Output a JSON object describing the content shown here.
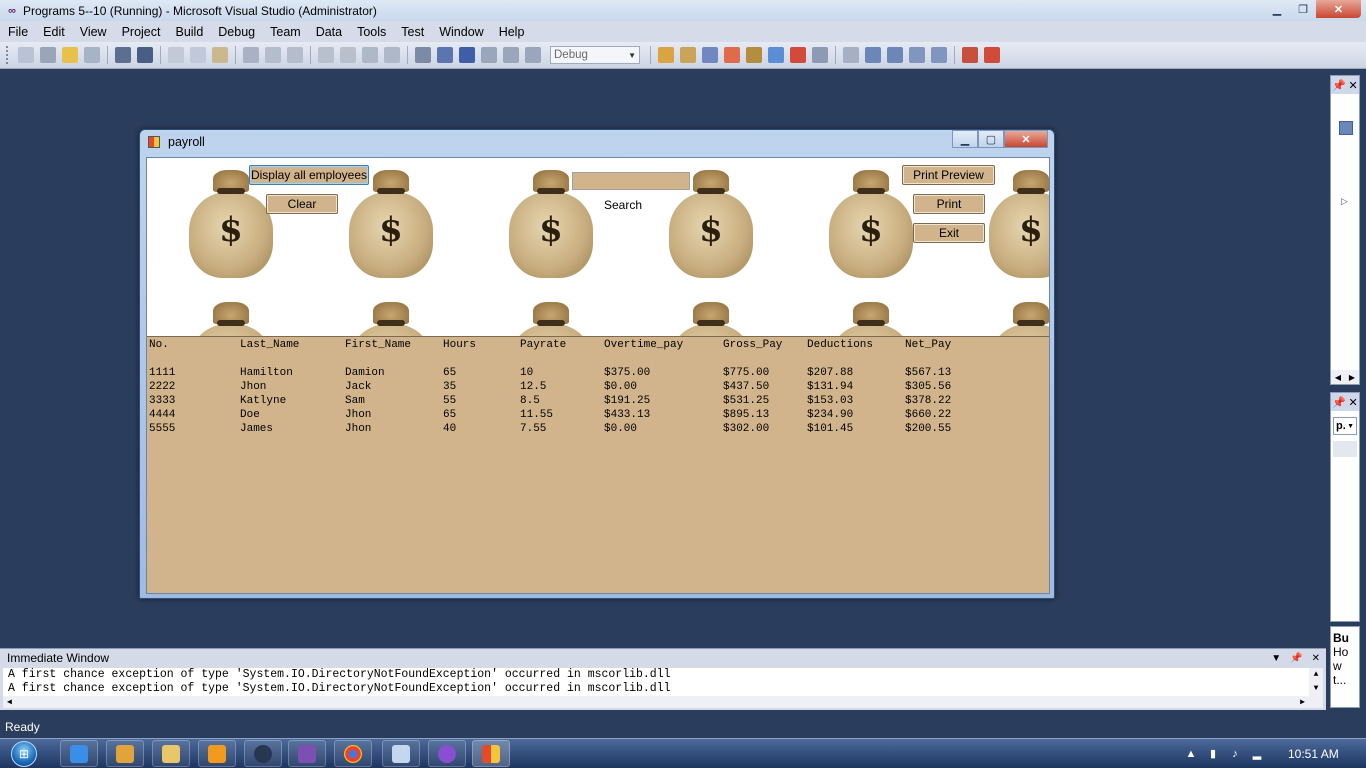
{
  "vs": {
    "title": "Programs 5--10 (Running) - Microsoft Visual Studio (Administrator)",
    "menu": [
      "File",
      "Edit",
      "View",
      "Project",
      "Build",
      "Debug",
      "Team",
      "Data",
      "Tools",
      "Test",
      "Window",
      "Help"
    ],
    "config_combo": "Debug",
    "status": "Ready"
  },
  "immediate": {
    "title": "Immediate Window",
    "lines": [
      "A first chance exception of type 'System.IO.DirectoryNotFoundException' occurred in mscorlib.dll",
      "A first chance exception of type 'System.IO.DirectoryNotFoundException' occurred in mscorlib.dll"
    ]
  },
  "right_panel": {
    "item_p": "p.",
    "bottom_lines": [
      "Bu",
      "Ho",
      "w",
      "t..."
    ]
  },
  "form": {
    "title": "payroll",
    "buttons": {
      "display_all": "Display all employees",
      "clear": "Clear",
      "search_label": "Search",
      "print_preview": "Print Preview",
      "print": "Print",
      "exit": "Exit"
    },
    "search_value": "",
    "columns": [
      "No.",
      "Last_Name",
      "First_Name",
      "Hours",
      "Payrate",
      "Overtime_pay",
      "Gross_Pay",
      "Deductions",
      "Net_Pay"
    ],
    "rows": [
      [
        "1111",
        "Hamilton",
        "Damion",
        "65",
        "10",
        "$375.00",
        "$775.00",
        "$207.88",
        "$567.13"
      ],
      [
        "2222",
        "Jhon",
        "Jack",
        "35",
        "12.5",
        "$0.00",
        "$437.50",
        "$131.94",
        "$305.56"
      ],
      [
        "3333",
        "Katlyne",
        "Sam",
        "55",
        "8.5",
        "$191.25",
        "$531.25",
        "$153.03",
        "$378.22"
      ],
      [
        "4444",
        "Doe",
        "Jhon",
        "65",
        "11.55",
        "$433.13",
        "$895.13",
        "$234.90",
        "$660.22"
      ],
      [
        "5555",
        "James",
        "Jhon",
        "40",
        "7.55",
        "$0.00",
        "$302.00",
        "$101.45",
        "$200.55"
      ]
    ],
    "bag_symbol": "$"
  },
  "taskbar": {
    "clock": "10:51 AM"
  },
  "colors": {
    "desktop": "#2b3d5c",
    "list_bg": "#d2b48c",
    "button_bg": "#d2b48c"
  }
}
